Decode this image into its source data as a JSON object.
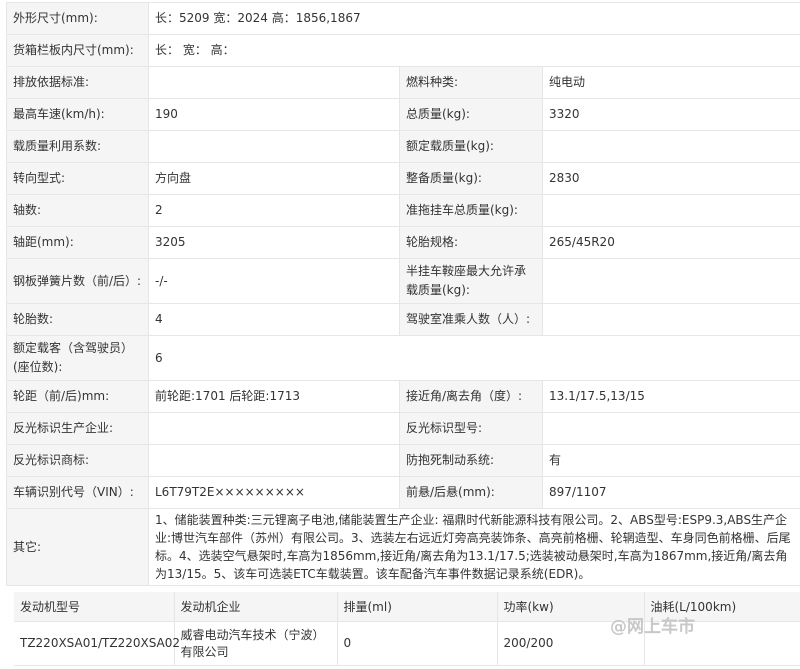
{
  "spec_rows": [
    {
      "l1": "外形尺寸(mm):",
      "v1": "长：5209 宽：2024 高：1856,1867"
    },
    {
      "l1": "货箱栏板内尺寸(mm):",
      "v1": "长： 宽： 高："
    },
    {
      "l1": "排放依据标准:",
      "v1": "",
      "l2": "燃料种类:",
      "v2": "纯电动"
    },
    {
      "l1": "最高车速(km/h):",
      "v1": "190",
      "l2": "总质量(kg):",
      "v2": "3320"
    },
    {
      "l1": "载质量利用系数:",
      "v1": "",
      "l2": "额定载质量(kg):",
      "v2": ""
    },
    {
      "l1": "转向型式:",
      "v1": "方向盘",
      "l2": "整备质量(kg):",
      "v2": "2830"
    },
    {
      "l1": "轴数:",
      "v1": "2",
      "l2": "准拖挂车总质量(kg):",
      "v2": ""
    },
    {
      "l1": "轴距(mm):",
      "v1": "3205",
      "l2": "轮胎规格:",
      "v2": "265/45R20"
    },
    {
      "l1": "钢板弹簧片数（前/后）:",
      "v1": "-/-",
      "l2": "半挂车鞍座最大允许承载质量(kg):",
      "v2": ""
    },
    {
      "l1": "轮胎数:",
      "v1": "4",
      "l2": "驾驶室准乘人数（人）:",
      "v2": ""
    },
    {
      "l1": "额定载客（含驾驶员）(座位数):",
      "v1": "6"
    },
    {
      "l1": "轮距（前/后)mm:",
      "v1": "前轮距:1701 后轮距:1713",
      "l2": "接近角/离去角（度）:",
      "v2": "13.1/17.5,13/15"
    },
    {
      "l1": "反光标识生产企业:",
      "v1": "",
      "l2": "反光标识型号:",
      "v2": ""
    },
    {
      "l1": "反光标识商标:",
      "v1": "",
      "l2": "防抱死制动系统:",
      "v2": "有"
    },
    {
      "l1": "车辆识别代号（VIN）:",
      "v1": "L6T79T2E×××××××××",
      "l2": "前悬/后悬(mm):",
      "v2": "897/1107"
    },
    {
      "l1": "其它:",
      "v1": "1、储能装置种类:三元锂离子电池,储能装置生产企业: 福鼎时代新能源科技有限公司。2、ABS型号:ESP9.3,ABS生产企业:博世汽车部件（苏州）有限公司。3、选装左右远近灯旁高亮装饰条、高亮前格栅、轮辋造型、车身同色前格栅、后尾标。4、选装空气悬架时,车高为1856mm,接近角/离去角为13.1/17.5;选装被动悬架时,车高为1867mm,接近角/离去角为13/15。5、该车可选装ETC车载装置。该车配备汽车事件数据记录系统(EDR)。"
    }
  ],
  "engine": {
    "headers": [
      "发动机型号",
      "发动机企业",
      "排量(ml)",
      "功率(kw)",
      "油耗(L/100km)"
    ],
    "row": [
      "TZ220XSA01/TZ220XSA02",
      "威睿电动汽车技术（宁波）有限公司",
      "0",
      "200/200",
      ""
    ]
  },
  "watermark": "@网上车市"
}
